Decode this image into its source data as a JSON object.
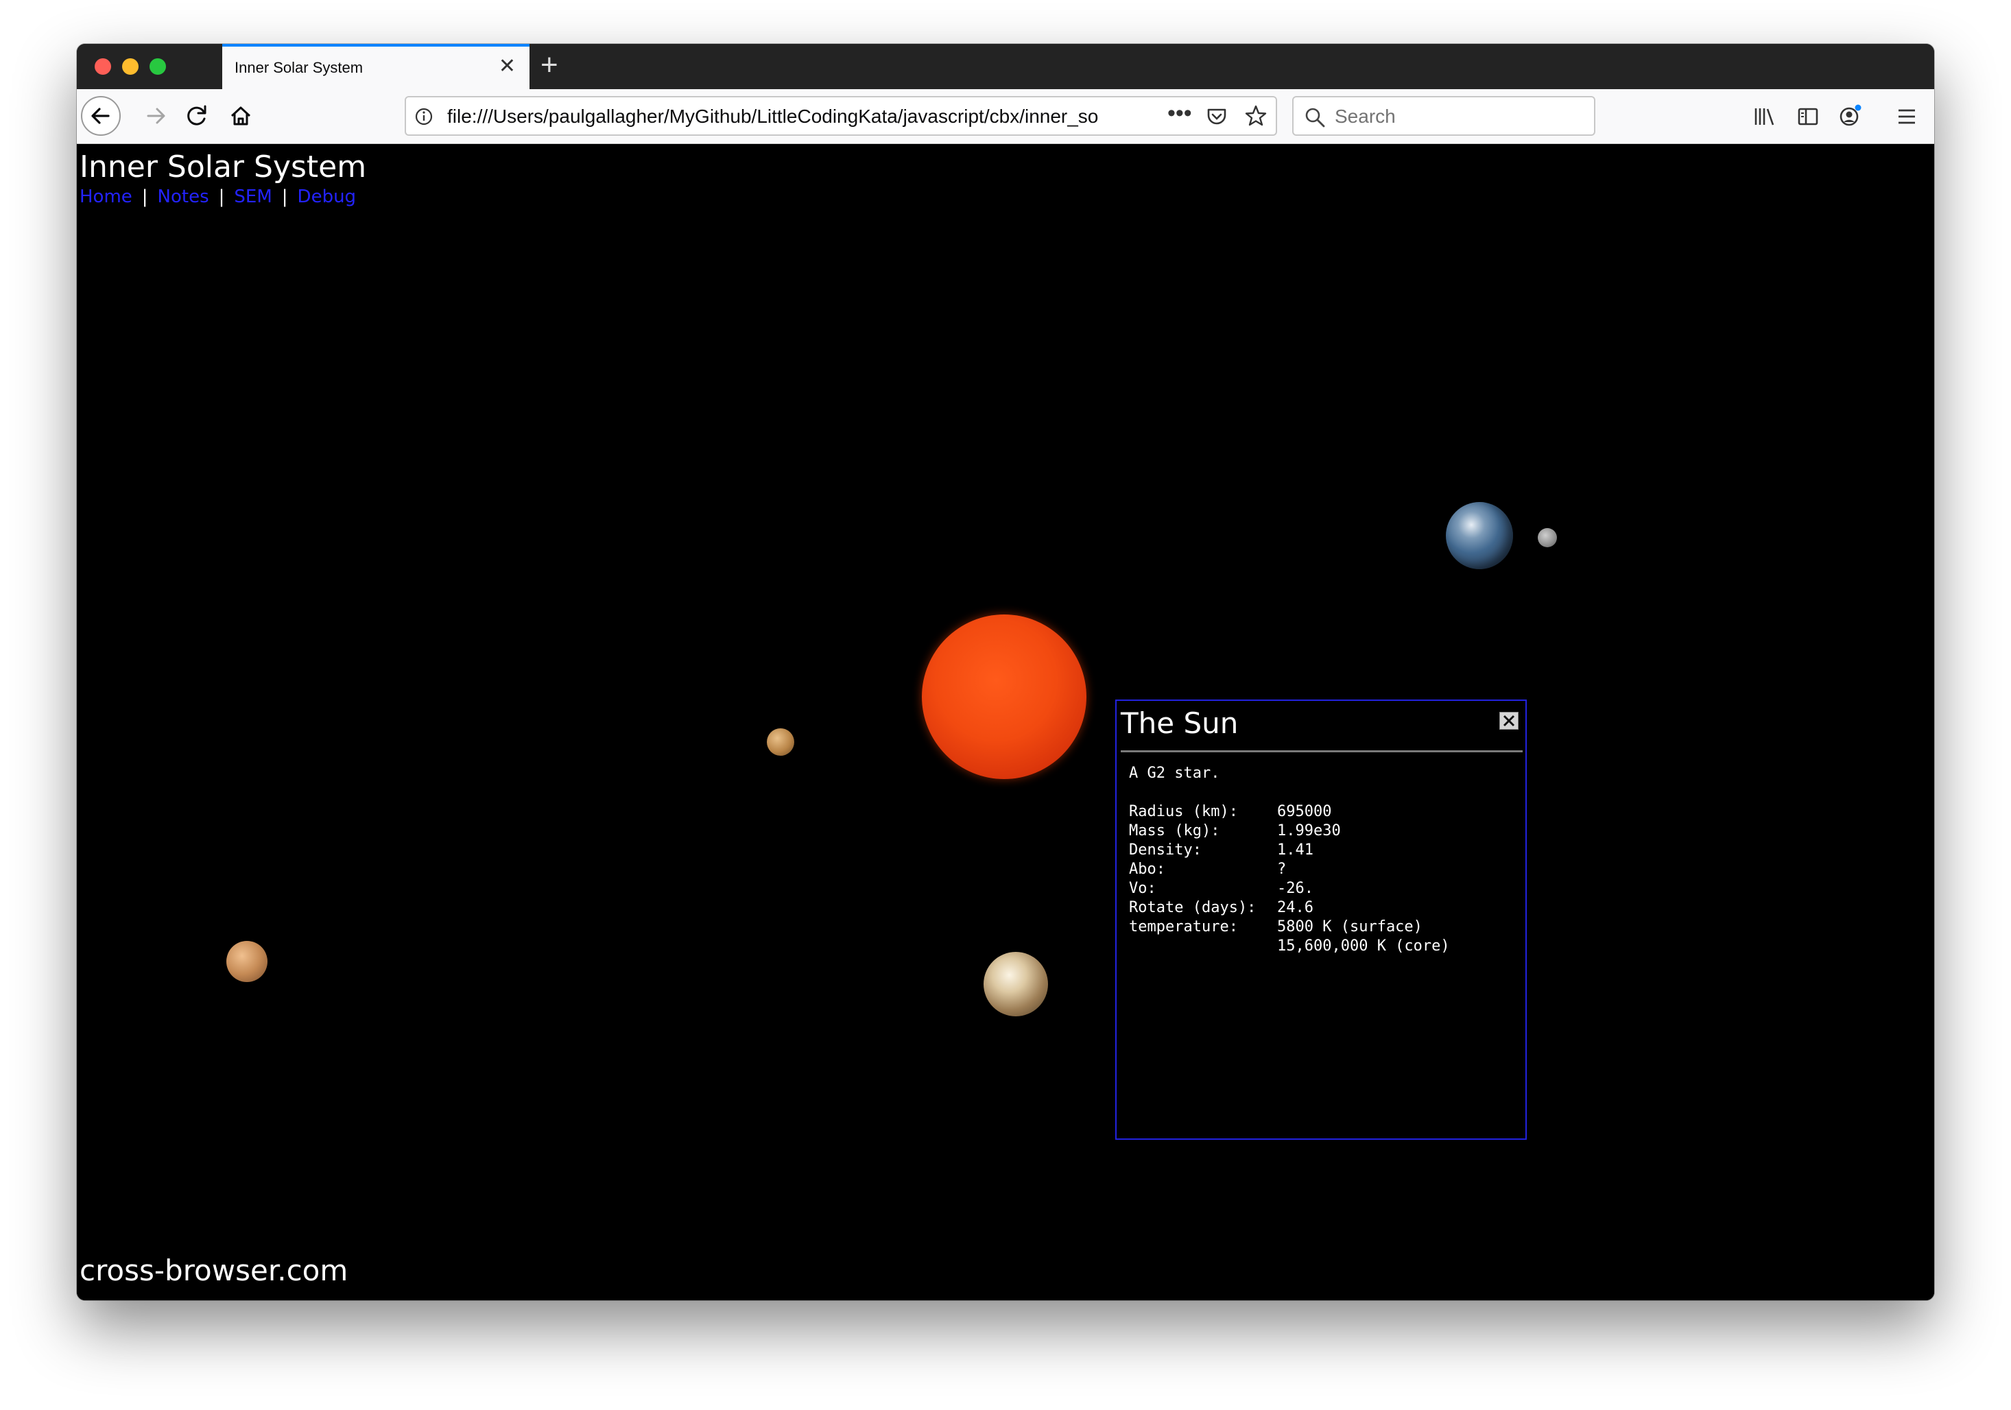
{
  "browser": {
    "tab_title": "Inner Solar System",
    "tab_close": "✕",
    "new_tab": "+",
    "url": "file:///Users/paulgallagher/MyGithub/LittleCodingKata/javascript/cbx/inner_so",
    "url_more": "•••",
    "search_placeholder": "Search"
  },
  "page": {
    "title": "Inner Solar System",
    "nav": [
      {
        "label": "Home"
      },
      {
        "label": "Notes"
      },
      {
        "label": "SEM"
      },
      {
        "label": "Debug"
      }
    ],
    "footer": "cross-browser.com"
  },
  "info_panel": {
    "title": "The Sun",
    "description": "A G2 star.",
    "rows": [
      {
        "key": "Radius (km):",
        "value": "695000"
      },
      {
        "key": "Mass (kg):",
        "value": "1.99e30"
      },
      {
        "key": "Density:",
        "value": "1.41"
      },
      {
        "key": "Abo:",
        "value": "?"
      },
      {
        "key": "Vo:",
        "value": "-26."
      },
      {
        "key": "Rotate (days):",
        "value": "24.6"
      },
      {
        "key": "temperature:",
        "value": "5800 K (surface)"
      },
      {
        "key": "",
        "value": "15,600,000 K (core)"
      }
    ]
  },
  "colors": {
    "link": "#2323ff",
    "panel_border": "#2222dd",
    "tab_accent": "#0a84ff"
  }
}
